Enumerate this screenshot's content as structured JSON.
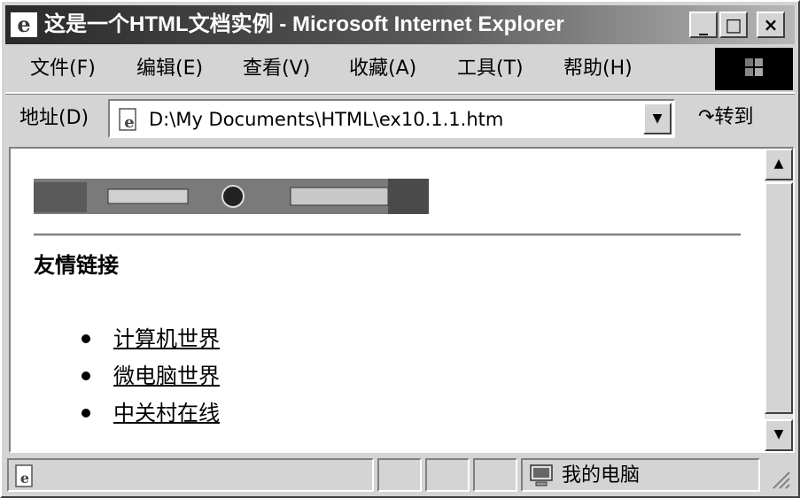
{
  "window": {
    "title": "这是一个HTML文档实例 - Microsoft Internet Explorer",
    "controls": {
      "minimize": "_",
      "maximize": "□",
      "close": "×"
    }
  },
  "menu": {
    "items": [
      {
        "label": "文件(F)"
      },
      {
        "label": "编辑(E)"
      },
      {
        "label": "查看(V)"
      },
      {
        "label": "收藏(A)"
      },
      {
        "label": "工具(T)"
      },
      {
        "label": "帮助(H)"
      }
    ]
  },
  "address_bar": {
    "label": "地址(D)",
    "value": "D:\\My Documents\\HTML\\ex10.1.1.htm",
    "go_label": "转到",
    "go_icon": "go-arrow-icon"
  },
  "page": {
    "heading": "友情链接",
    "links": [
      {
        "label": "计算机世界"
      },
      {
        "label": "微电脑世界"
      },
      {
        "label": "中关村在线"
      }
    ]
  },
  "status_bar": {
    "zone_label": "我的电脑",
    "zone_icon": "computer-icon"
  }
}
